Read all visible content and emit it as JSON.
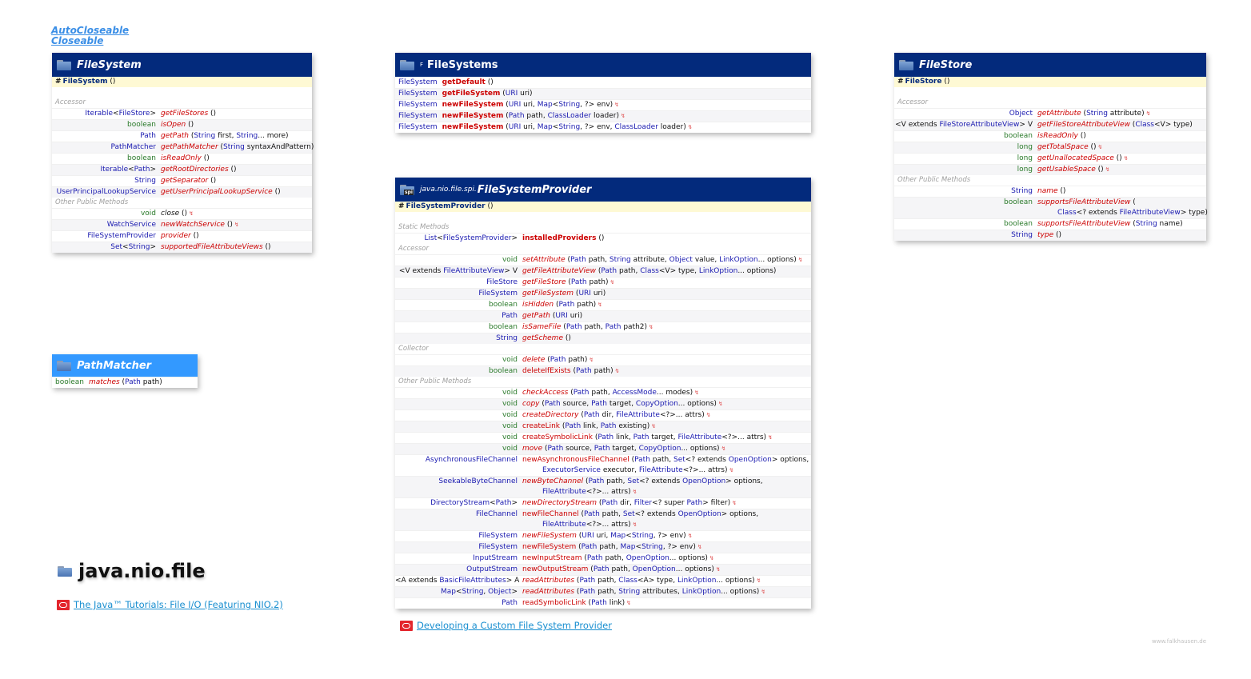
{
  "interfaces": [
    "AutoCloseable",
    "Closeable"
  ],
  "filesystem": {
    "title": "FileSystem",
    "constructor": "FileSystem",
    "sections": [
      {
        "label": "Accessor",
        "rows": [
          {
            "ret": "Iterable<FileStore>",
            "rk": "t",
            "name": "getFileStores",
            "args": "()"
          },
          {
            "ret": "boolean",
            "rk": "p",
            "name": "isOpen",
            "args": "()"
          },
          {
            "ret": "Path",
            "rk": "t",
            "name": "getPath",
            "args": "(String first, String... more)"
          },
          {
            "ret": "PathMatcher",
            "rk": "t",
            "name": "getPathMatcher",
            "args": "(String syntaxAndPattern)"
          },
          {
            "ret": "boolean",
            "rk": "p",
            "name": "isReadOnly",
            "args": "()"
          },
          {
            "ret": "Iterable<Path>",
            "rk": "t",
            "name": "getRootDirectories",
            "args": "()"
          },
          {
            "ret": "String",
            "rk": "t",
            "name": "getSeparator",
            "args": "()"
          },
          {
            "ret": "UserPrincipalLookupService",
            "rk": "t",
            "name": "getUserPrincipalLookupService",
            "args": "()"
          }
        ]
      },
      {
        "label": "Other Public Methods",
        "rows": [
          {
            "ret": "void",
            "rk": "p",
            "name": "close",
            "args": "()",
            "throws": true,
            "black": true
          },
          {
            "ret": "WatchService",
            "rk": "t",
            "name": "newWatchService",
            "args": "()",
            "throws": true
          },
          {
            "ret": "FileSystemProvider",
            "rk": "t",
            "name": "provider",
            "args": "()"
          },
          {
            "ret": "Set<String>",
            "rk": "t",
            "name": "supportedFileAttributeViews",
            "args": "()"
          }
        ]
      }
    ]
  },
  "pathmatcher": {
    "title": "PathMatcher",
    "rows": [
      {
        "ret": "boolean",
        "rk": "p",
        "name": "matches",
        "args": "(Path path)"
      }
    ]
  },
  "filesystems": {
    "title": "FileSystems",
    "final_mark": "F",
    "rows": [
      {
        "ret": "FileSystem",
        "name": "getDefault",
        "args": "()"
      },
      {
        "ret": "FileSystem",
        "name": "getFileSystem",
        "args": "(URI uri)"
      },
      {
        "ret": "FileSystem",
        "name": "newFileSystem",
        "args": "(URI uri, Map<String, ?> env)",
        "throws": true
      },
      {
        "ret": "FileSystem",
        "name": "newFileSystem",
        "args": "(Path path, ClassLoader loader)",
        "throws": true
      },
      {
        "ret": "FileSystem",
        "name": "newFileSystem",
        "args": "(URI uri, Map<String, ?> env, ClassLoader loader)",
        "throws": true
      }
    ]
  },
  "provider": {
    "package_prefix": "java.nio.file.spi.",
    "title": "FileSystemProvider",
    "spi_badge": "spi",
    "constructor": "FileSystemProvider",
    "sections": [
      {
        "label": "Static Methods",
        "rows": [
          {
            "ret": "List<FileSystemProvider>",
            "rk": "t",
            "name": "installedProviders",
            "args": "()",
            "style": "b"
          }
        ]
      },
      {
        "label": "Accessor",
        "rows": [
          {
            "ret": "void",
            "rk": "p",
            "name": "setAttribute",
            "args": "(Path path, String attribute, Object value, LinkOption... options)",
            "throws": true
          },
          {
            "ret": "<V extends FileAttributeView> V",
            "rk": "k",
            "name": "getFileAttributeView",
            "args": "(Path path, Class<V> type, LinkOption... options)"
          },
          {
            "ret": "FileStore",
            "rk": "t",
            "name": "getFileStore",
            "args": "(Path path)",
            "throws": true
          },
          {
            "ret": "FileSystem",
            "rk": "t",
            "name": "getFileSystem",
            "args": "(URI uri)"
          },
          {
            "ret": "boolean",
            "rk": "p",
            "name": "isHidden",
            "args": "(Path path)",
            "throws": true
          },
          {
            "ret": "Path",
            "rk": "t",
            "name": "getPath",
            "args": "(URI uri)"
          },
          {
            "ret": "boolean",
            "rk": "p",
            "name": "isSameFile",
            "args": "(Path path, Path path2)",
            "throws": true
          },
          {
            "ret": "String",
            "rk": "t",
            "name": "getScheme",
            "args": "()"
          }
        ]
      },
      {
        "label": "Collector",
        "rows": [
          {
            "ret": "void",
            "rk": "p",
            "name": "delete",
            "args": "(Path path)",
            "throws": true
          },
          {
            "ret": "boolean",
            "rk": "p",
            "name": "deleteIfExists",
            "args": "(Path path)",
            "throws": true,
            "style": "n"
          }
        ]
      },
      {
        "label": "Other Public Methods",
        "rows": [
          {
            "ret": "void",
            "rk": "p",
            "name": "checkAccess",
            "args": "(Path path, AccessMode... modes)",
            "throws": true
          },
          {
            "ret": "void",
            "rk": "p",
            "name": "copy",
            "args": "(Path source, Path target, CopyOption... options)",
            "throws": true
          },
          {
            "ret": "void",
            "rk": "p",
            "name": "createDirectory",
            "args": "(Path dir, FileAttribute<?>... attrs)",
            "throws": true
          },
          {
            "ret": "void",
            "rk": "p",
            "name": "createLink",
            "args": "(Path link, Path existing)",
            "throws": true,
            "style": "n"
          },
          {
            "ret": "void",
            "rk": "p",
            "name": "createSymbolicLink",
            "args": "(Path link, Path target, FileAttribute<?>... attrs)",
            "throws": true,
            "style": "n"
          },
          {
            "ret": "void",
            "rk": "p",
            "name": "move",
            "args": "(Path source, Path target, CopyOption... options)",
            "throws": true
          },
          {
            "ret": "AsynchronousFileChannel",
            "rk": "t",
            "name": "newAsynchronousFileChannel",
            "args": "(Path path, Set<? extends OpenOption> options,",
            "args2": "ExecutorService executor, FileAttribute<?>... attrs)",
            "throws": true,
            "style": "n"
          },
          {
            "ret": "SeekableByteChannel",
            "rk": "t",
            "name": "newByteChannel",
            "args": "(Path path, Set<? extends OpenOption> options,",
            "args2": "FileAttribute<?>... attrs)",
            "throws": true
          },
          {
            "ret": "DirectoryStream<Path>",
            "rk": "t",
            "name": "newDirectoryStream",
            "args": "(Path dir, Filter<? super Path> filter)",
            "throws": true
          },
          {
            "ret": "FileChannel",
            "rk": "t",
            "name": "newFileChannel",
            "args": "(Path path, Set<? extends OpenOption> options,",
            "args2": "FileAttribute<?>... attrs)",
            "throws": true,
            "style": "n"
          },
          {
            "ret": "FileSystem",
            "rk": "t",
            "name": "newFileSystem",
            "args": "(URI uri, Map<String, ?> env)",
            "throws": true
          },
          {
            "ret": "FileSystem",
            "rk": "t",
            "name": "newFileSystem",
            "args": "(Path path, Map<String, ?> env)",
            "throws": true,
            "style": "n"
          },
          {
            "ret": "InputStream",
            "rk": "t",
            "name": "newInputStream",
            "args": "(Path path, OpenOption... options)",
            "throws": true,
            "style": "n"
          },
          {
            "ret": "OutputStream",
            "rk": "t",
            "name": "newOutputStream",
            "args": "(Path path, OpenOption... options)",
            "throws": true,
            "style": "n"
          },
          {
            "ret": "<A extends BasicFileAttributes> A",
            "rk": "k",
            "name": "readAttributes",
            "args": "(Path path, Class<A> type, LinkOption... options)",
            "throws": true
          },
          {
            "ret": "Map<String, Object>",
            "rk": "t",
            "name": "readAttributes",
            "args": "(Path path, String attributes, LinkOption... options)",
            "throws": true
          },
          {
            "ret": "Path",
            "rk": "t",
            "name": "readSymbolicLink",
            "args": "(Path link)",
            "throws": true,
            "style": "n"
          }
        ]
      }
    ]
  },
  "filestore": {
    "title": "FileStore",
    "constructor": "FileStore",
    "sections": [
      {
        "label": "Accessor",
        "rows": [
          {
            "ret": "Object",
            "rk": "t",
            "name": "getAttribute",
            "args": "(String attribute)",
            "throws": true
          },
          {
            "ret": "<V extends FileStoreAttributeView> V",
            "rk": "k",
            "name": "getFileStoreAttributeView",
            "args": "(Class<V> type)"
          },
          {
            "ret": "boolean",
            "rk": "p",
            "name": "isReadOnly",
            "args": "()"
          },
          {
            "ret": "long",
            "rk": "p",
            "name": "getTotalSpace",
            "args": "()",
            "throws": true
          },
          {
            "ret": "long",
            "rk": "p",
            "name": "getUnallocatedSpace",
            "args": "()",
            "throws": true
          },
          {
            "ret": "long",
            "rk": "p",
            "name": "getUsableSpace",
            "args": "()",
            "throws": true
          }
        ]
      },
      {
        "label": "Other Public Methods",
        "rows": [
          {
            "ret": "String",
            "rk": "t",
            "name": "name",
            "args": "()"
          },
          {
            "ret": "boolean",
            "rk": "p",
            "name": "supportsFileAttributeView",
            "args": "(",
            "args2": "Class<? extends FileAttributeView> type)"
          },
          {
            "ret": "boolean",
            "rk": "p",
            "name": "supportsFileAttributeView",
            "args": "(String name)"
          },
          {
            "ret": "String",
            "rk": "t",
            "name": "type",
            "args": "()"
          }
        ]
      }
    ]
  },
  "package": {
    "name": "java.nio.file",
    "links": [
      {
        "label": "The Java™ Tutorials: File I/O (Featuring NIO.2)"
      },
      {
        "label": "Developing a Custom File System Provider"
      }
    ]
  },
  "credit": "www.falkhausen.de",
  "throws_icon": "↯",
  "colors": {
    "header": "#032a7c",
    "header_light": "#3399ff",
    "constructor_bg": "#fef9d4",
    "type": "#1a1ab0",
    "primitive": "#2a7a2a",
    "method": "#cc0000"
  }
}
